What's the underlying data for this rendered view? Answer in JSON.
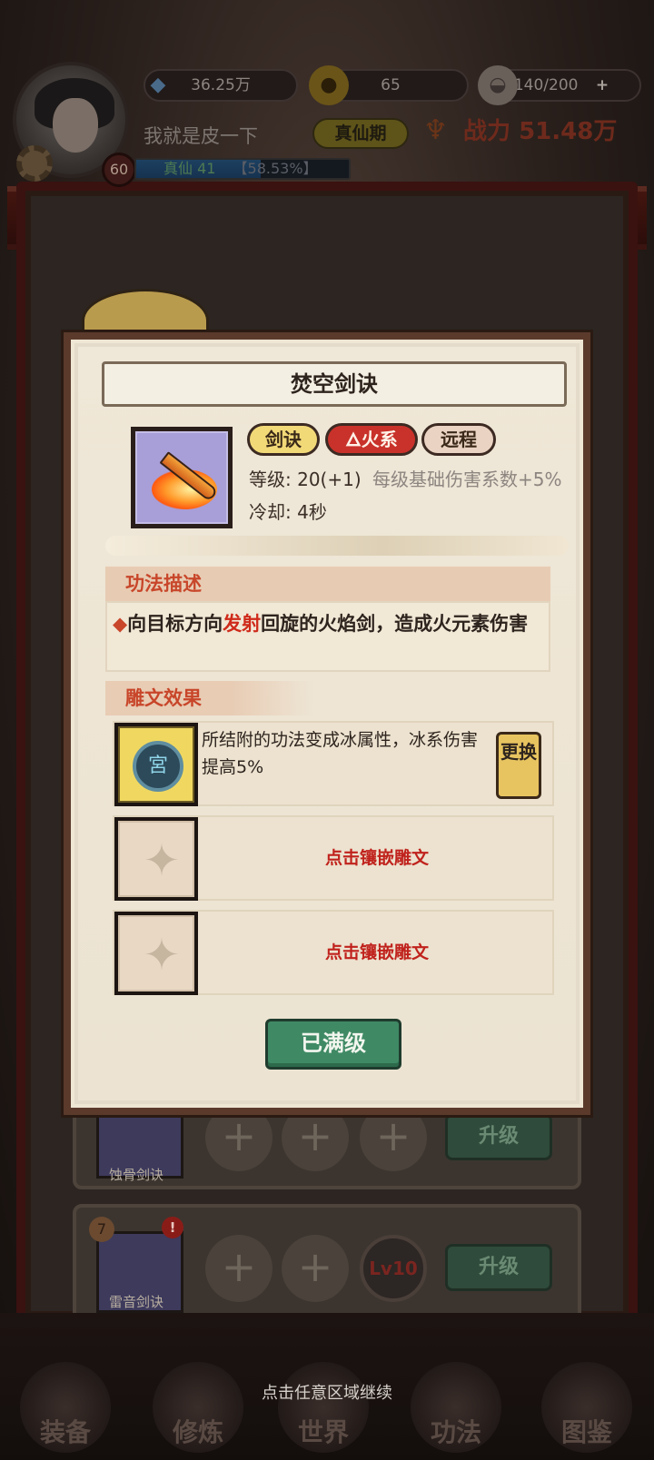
{
  "player": {
    "name": "我就是皮一下",
    "level": "60",
    "realm_badge": "真仙期",
    "exp_label": "真仙 41",
    "exp_percent_text": "【58.53%】",
    "exp_progress": 0.5853,
    "power_label": "战力",
    "power_value": "51.48万"
  },
  "resources": {
    "crystal": "36.25万",
    "gold": "65",
    "stamina": "140/200",
    "add_symbol": "+"
  },
  "modal": {
    "title": "焚空剑诀",
    "tags": {
      "type": "剑诀",
      "element": "火系",
      "range": "远程"
    },
    "stats": {
      "level_label": "等级:",
      "level_value": "20(+1)",
      "level_extra": "每级基础伤害系数+5%",
      "cooldown_label": "冷却:",
      "cooldown_value": "4秒"
    },
    "description_header": "功法描述",
    "description_bullet": "◆",
    "description_part1": "向目标方向",
    "description_highlight": "发射",
    "description_part2": "回旋的火焰剑，造成火元素伤害",
    "rune_header": "雕文效果",
    "rune_slots": [
      {
        "text": "所结附的功法变成冰属性，冰系伤害提高5%",
        "swap_label": "更换",
        "medal_glyph": "宮"
      },
      {
        "text": "点击镶嵌雕文"
      },
      {
        "text": "点击镶嵌雕文"
      }
    ],
    "max_button": "已满级"
  },
  "background": {
    "skills": [
      {
        "name": "蚀骨剑诀",
        "upgrade": "升级"
      },
      {
        "name": "雷音剑诀",
        "upgrade": "升级",
        "badge": "7",
        "alert": "!",
        "lv": "Lv10"
      }
    ],
    "plus": "+"
  },
  "continue_hint": "点击任意区域继续",
  "nav": [
    {
      "label": "装备"
    },
    {
      "label": "修炼"
    },
    {
      "label": "世界"
    },
    {
      "label": "功法"
    },
    {
      "label": "图鉴"
    }
  ],
  "colors": {
    "accent_red": "#c8462a",
    "max_button_green": "#3f8a65",
    "fire_tag": "#c8322a"
  }
}
